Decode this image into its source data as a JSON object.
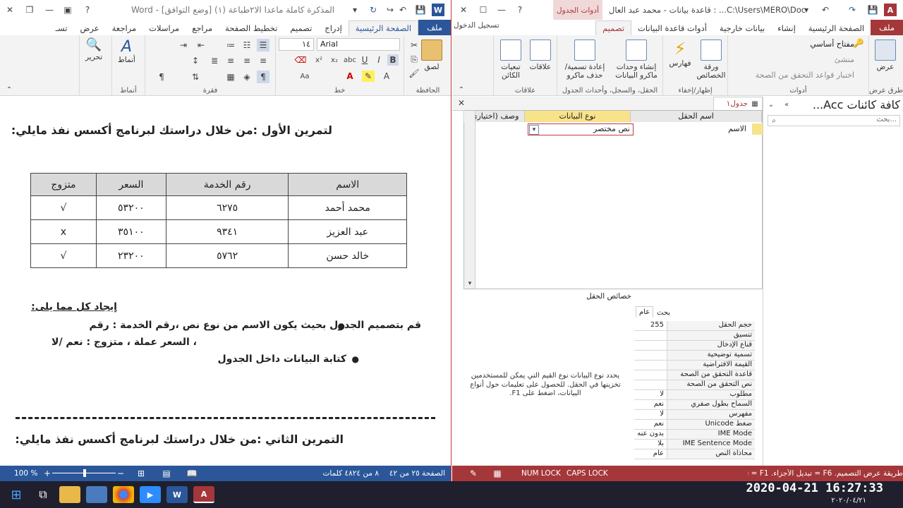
{
  "word": {
    "title": "المذكرة كاملة ماعدا الا٢طباعة (١) [وضع التوافق] - Word",
    "tabs": [
      "ملف",
      "الصفحة الرئيسية",
      "إدراج",
      "تصميم",
      "تخطيط الصفحة",
      "مراجع",
      "مراسلات",
      "مراجعة",
      "عرض",
      "تسـ"
    ],
    "font_name": "Arial",
    "font_size": "١٤",
    "groups": {
      "clipboard": "الحافظة",
      "font": "خط",
      "paragraph": "فقرة",
      "styles": "أنماط",
      "editing": "تحرير"
    },
    "buttons": {
      "paste": "لصق",
      "styles": "أنماط",
      "edit": "تحرير"
    },
    "doc": {
      "ex1_title": "لتمرين الأول :من خلال دراستك لبرنامج أكسس نفذ مايلي:",
      "table_headers": [
        "الاسم",
        "رقم الخدمة",
        "السعر",
        "متزوج"
      ],
      "table_rows": [
        [
          "محمد أحمد",
          "٦٢٧٥",
          "٥٣٢٠٠",
          "√"
        ],
        [
          "عبد العزيز",
          "٩٣٤١",
          "٣٥١٠٠",
          "x"
        ],
        [
          "خالد حسن",
          "٥٧٦٢",
          "٢٣٢٠٠",
          "√"
        ]
      ],
      "find_title": "إيجاد كل مما يلى:",
      "bullet1a": "قم بتصميم الجدول  بحيث يكون الاسم من نوع نص ،رقم الخدمة : رقم",
      "bullet1b": "، السعر عملة ، متزوج  : نعم /لا",
      "bullet2": "كتابة البيانات داخل الجدول",
      "ex2_title": "التمرين الثاني :من خلال دراستك لبرنامج أكسس نفذ مايلي:"
    },
    "status": {
      "page": "الصفحة ٢٥ من ٤٢",
      "words": "٨ من ٤٨٢٤ كلمات",
      "zoom": "100 %"
    }
  },
  "access": {
    "title": "C:\\Users\\MERO\\Doc... : قاعدة بيانات - محمد عبد العال",
    "table_tools": "أدوات الجدول",
    "signin": "تسجيل الدخول",
    "tabs": [
      "ملف",
      "الصفحة الرئيسية",
      "إنشاء",
      "بيانات خارجية",
      "أدوات قاعدة البيانات",
      "تصميم"
    ],
    "ribbon": {
      "view": "عرض",
      "primary_key": "مفتاح أساسي",
      "builder": "منشئ",
      "test_rules": "اختبار قواعد التحقق من الصحة",
      "tools_group": "أدوات",
      "views_group": "طرق عرض",
      "sheet": "ورقة الخصائص",
      "indexes": "فهارس",
      "show_group": "إظهار/إخفاء",
      "macros": "إنشاء وحدات ماكرو البيانات",
      "rename": "إعادة تسمية/ حذف ماكرو",
      "events_group": "الحقل، والسجل، وأحداث الجدول",
      "relations": "علاقات",
      "deps": "تبعيات الكائن",
      "rel_group": "علاقات"
    },
    "nav_title": "كافة كائنات Acc...",
    "nav_search": "بحث...",
    "table_tab": "جدول١",
    "grid_headers": [
      "اسم الحقل",
      "نوع البيانات",
      "وصف (اختياري)"
    ],
    "row1": {
      "field": "الاسم",
      "type": "نص مختصر"
    },
    "props_title": "خصائص الحقل",
    "props_tabs": [
      "عام",
      "بحث"
    ],
    "props": [
      [
        "حجم الحقل",
        "255"
      ],
      [
        "تنسيق",
        ""
      ],
      [
        "قناع الإدخال",
        ""
      ],
      [
        "تسمية توضيحية",
        ""
      ],
      [
        "القيمة الافتراضية",
        ""
      ],
      [
        "قاعدة التحقق من الصحة",
        ""
      ],
      [
        "نص التحقق من الصحة",
        ""
      ],
      [
        "مطلوب",
        "لا"
      ],
      [
        "السماح بطول صفري",
        "نعم"
      ],
      [
        "مفهرس",
        "لا"
      ],
      [
        "ضغط Unicode",
        "نعم"
      ],
      [
        "IME Mode",
        "بدون عنه"
      ],
      [
        "IME Sentence Mode",
        "بلا"
      ],
      [
        "محاذاة النص",
        "عام"
      ]
    ],
    "help": "يحدد نوع البيانات نوع القيم التي يمكن للمستخدمين تخزينها في الحقل. للحصول على تعليمات حول أنواع البيانات، اضغط على F1.",
    "status": {
      "hint": "طريقة عرض التصميم. F6 = تبديل الأجزاء. F1 = تعليمات.",
      "num": "NUM LOCK",
      "caps": "CAPS LOCK"
    }
  },
  "taskbar": {
    "datetime": "2020-04-21 16:27:33",
    "date_small": "٢٠٢٠/٠٤/٢١"
  },
  "colors": {
    "word_blue": "#2b579a",
    "access_red": "#a4373a",
    "taskbar": "#1f1f2e"
  }
}
